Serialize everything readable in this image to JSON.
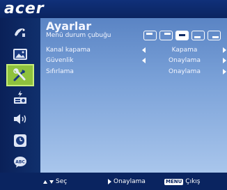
{
  "header": {
    "logo": "acer"
  },
  "sidebar": {
    "items": [
      {
        "icon": "satellite-dish-icon"
      },
      {
        "icon": "picture-icon"
      },
      {
        "icon": "settings-tools-icon",
        "active": true
      },
      {
        "icon": "power-management-icon"
      },
      {
        "icon": "audio-speaker-icon"
      },
      {
        "icon": "timer-clock-icon"
      },
      {
        "icon": "language-abc-icon"
      }
    ]
  },
  "panel": {
    "title": "Ayarlar",
    "rows": [
      {
        "label": "Menü durum çubuğu"
      },
      {
        "label": "Kanal kapama",
        "value": "Kapama"
      },
      {
        "label": "Güvenlik",
        "value": "Onaylama"
      },
      {
        "label": "Sıfırlama",
        "value": "Onaylama"
      }
    ],
    "menu_position_selected_index": 2
  },
  "footer": {
    "select_label": "Seç",
    "confirm_label": "Onaylama",
    "menu_key": "MENU",
    "exit_label": "Çıkış"
  },
  "colors": {
    "accent_green": "#8fc23e",
    "background": "#0e2a63"
  }
}
